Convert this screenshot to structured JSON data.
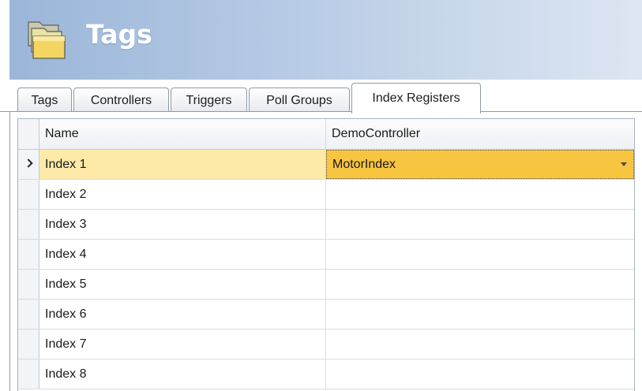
{
  "header": {
    "title": "Tags",
    "icon": "tags-folder-icon"
  },
  "tabs": [
    {
      "label": "Tags",
      "active": false
    },
    {
      "label": "Controllers",
      "active": false
    },
    {
      "label": "Triggers",
      "active": false
    },
    {
      "label": "Poll Groups",
      "active": false
    },
    {
      "label": "Index Registers",
      "active": true
    }
  ],
  "grid": {
    "columns": [
      "Name",
      "DemoController"
    ],
    "rows": [
      {
        "name": "Index 1",
        "controller": "MotorIndex",
        "current": true
      },
      {
        "name": "Index 2",
        "controller": ""
      },
      {
        "name": "Index 3",
        "controller": ""
      },
      {
        "name": "Index 4",
        "controller": ""
      },
      {
        "name": "Index 5",
        "controller": ""
      },
      {
        "name": "Index 6",
        "controller": ""
      },
      {
        "name": "Index 7",
        "controller": ""
      },
      {
        "name": "Index 8",
        "controller": ""
      }
    ]
  },
  "colors": {
    "selected_row": "#fde9a8",
    "selected_cell": "#f8c541",
    "header_gradient_start": "#9bb6d9"
  }
}
